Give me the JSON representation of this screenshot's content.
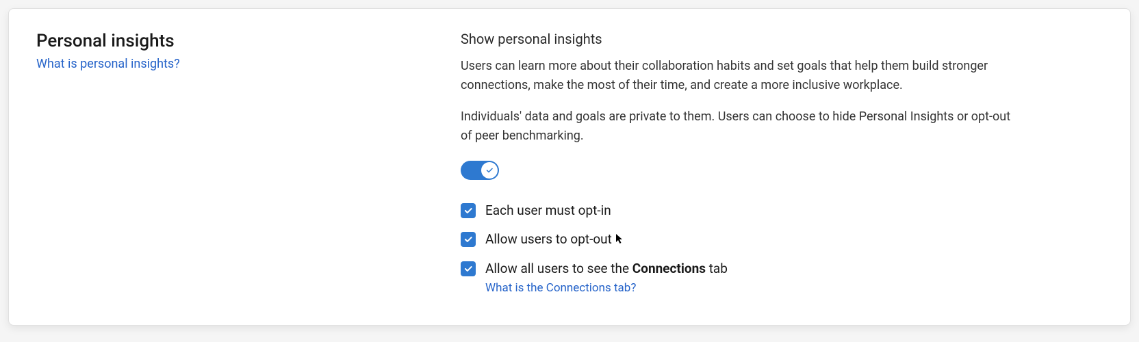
{
  "left": {
    "title": "Personal insights",
    "help_link": "What is personal insights?"
  },
  "right": {
    "heading": "Show personal insights",
    "description1": "Users can learn more about their collaboration habits and set goals that help them build stronger connections, make the most of their time, and create a more inclusive workplace.",
    "description2": "Individuals' data and goals are private to them. Users can choose to hide Personal Insights or opt-out of peer benchmarking.",
    "toggle_on": true,
    "options": [
      {
        "label_pre": "Each user must opt-in",
        "bold": "",
        "label_post": "",
        "checked": true,
        "sublink": ""
      },
      {
        "label_pre": "Allow users to opt-out",
        "bold": "",
        "label_post": "",
        "checked": true,
        "sublink": "",
        "cursor": true
      },
      {
        "label_pre": "Allow all users to see the ",
        "bold": "Connections",
        "label_post": " tab",
        "checked": true,
        "sublink": "What is the Connections tab?"
      }
    ]
  }
}
